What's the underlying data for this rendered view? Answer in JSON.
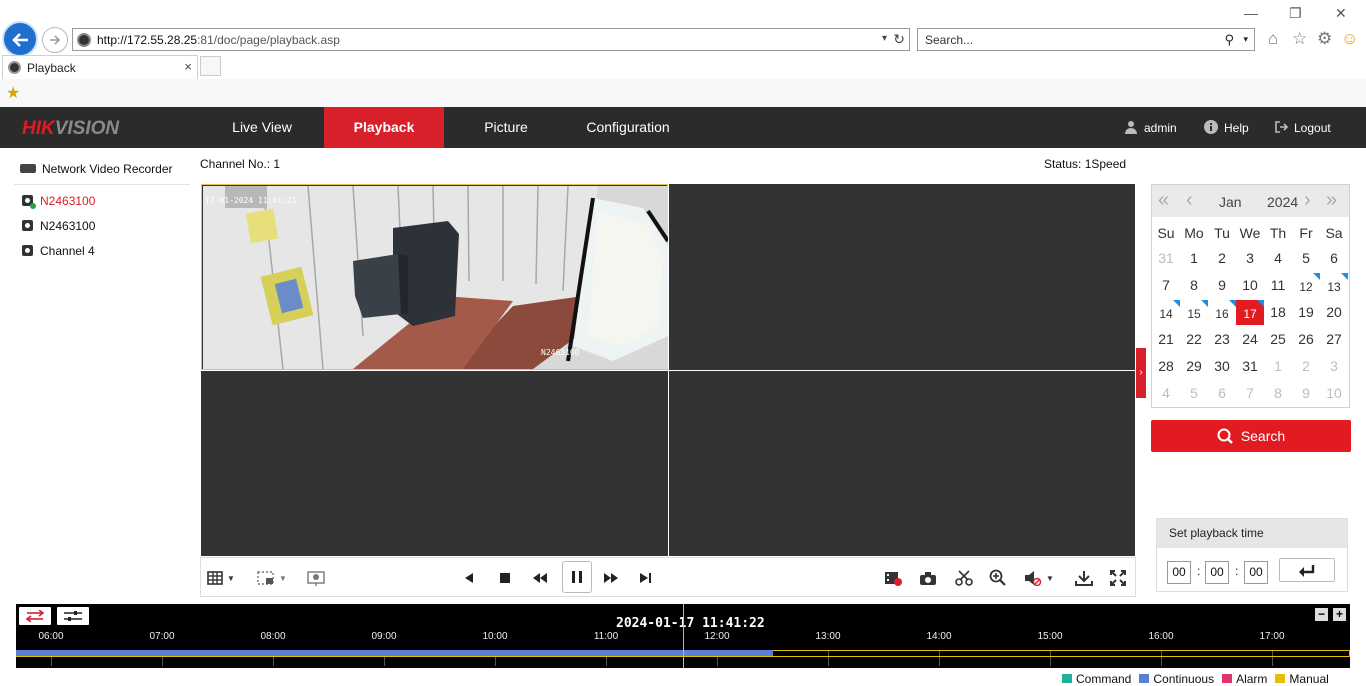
{
  "browser": {
    "url_host": "http://172.55.28.25",
    "url_rest": ":81/doc/page/playback.asp",
    "search_placeholder": "Search...",
    "tab_title": "Playback"
  },
  "header": {
    "logo_part1": "HIK",
    "logo_part2": "VISION",
    "nav": [
      "Live View",
      "Playback",
      "Picture",
      "Configuration"
    ],
    "active_nav": "Playback",
    "user": "admin",
    "help": "Help",
    "logout": "Logout"
  },
  "tree": {
    "root": "Network Video Recorder",
    "items": [
      {
        "label": "N2463100",
        "selected": true
      },
      {
        "label": "N2463100",
        "selected": false
      },
      {
        "label": "Channel 4",
        "selected": false
      }
    ]
  },
  "view": {
    "channel_label": "Channel No.: 1",
    "status_label": "Status: 1Speed",
    "osd_timestamp": "17-01-2024 11:41:21",
    "osd_name": "N2463100"
  },
  "calendar": {
    "month": "Jan",
    "year": "2024",
    "dow": [
      "Su",
      "Mo",
      "Tu",
      "We",
      "Th",
      "Fr",
      "Sa"
    ],
    "weeks": [
      [
        "31",
        "1",
        "2",
        "3",
        "4",
        "5",
        "6"
      ],
      [
        "7",
        "8",
        "9",
        "10",
        "11",
        "12",
        "13"
      ],
      [
        "14",
        "15",
        "16",
        "17",
        "18",
        "19",
        "20"
      ],
      [
        "21",
        "22",
        "23",
        "24",
        "25",
        "26",
        "27"
      ],
      [
        "28",
        "29",
        "30",
        "31",
        "1",
        "2",
        "3"
      ],
      [
        "4",
        "5",
        "6",
        "7",
        "8",
        "9",
        "10"
      ]
    ],
    "recorded_days": [
      "12",
      "13",
      "14",
      "15",
      "16",
      "17"
    ],
    "today": "17",
    "colors": {
      "today": "#e21b22",
      "record_marker": "#1d8ee0"
    }
  },
  "search_label": "Search",
  "playback_time": {
    "title": "Set playback time",
    "hh": "00",
    "mm": "00",
    "ss": "00"
  },
  "timeline": {
    "current_time": "2024-01-17 11:41:22",
    "hours": [
      "06:00",
      "07:00",
      "08:00",
      "09:00",
      "10:00",
      "11:00",
      "12:00",
      "13:00",
      "14:00",
      "15:00",
      "16:00",
      "17:00"
    ],
    "recording_end": "12:30",
    "colors": {
      "continuous": "#5b7fd6",
      "cursor": "#e0c000"
    }
  },
  "legend": [
    {
      "label": "Command",
      "color": "#1fb29a"
    },
    {
      "label": "Continuous",
      "color": "#5b7fd6"
    },
    {
      "label": "Alarm",
      "color": "#e0356a"
    },
    {
      "label": "Manual",
      "color": "#e8c000"
    }
  ]
}
